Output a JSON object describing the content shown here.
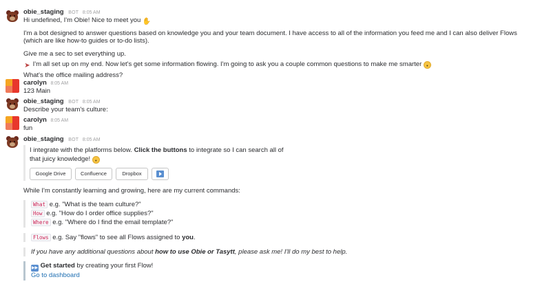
{
  "messages": {
    "m1": {
      "sender": "obie_staging",
      "bot_tag": "BOT",
      "time": "8:05 AM",
      "line1": "Hi undefined, I'm Obie!  Nice to meet you",
      "line2": "I'm a bot designed to answer questions based on knowledge you and your team document. I have access to all of the information you feed me and I can also deliver Flows (which are like how-to guides or to-do lists).",
      "line3": "Give me a sec to set everything up.",
      "line4": "I'm all set up on my end.  Now let's get some information flowing.  I'm going to ask you a couple common questions to make me smarter",
      "line5": "What's the office mailing address?"
    },
    "m2": {
      "sender": "carolyn",
      "time": "8:05 AM",
      "text": "123 Main"
    },
    "m3": {
      "sender": "obie_staging",
      "bot_tag": "BOT",
      "time": "8:05 AM",
      "text": "Describe your team's culture:"
    },
    "m4": {
      "sender": "carolyn",
      "time": "8:05 AM",
      "text": "fun"
    },
    "m5": {
      "sender": "obie_staging",
      "bot_tag": "BOT",
      "time": "8:05 AM",
      "integrate_pre": "I integrate with the platforms below. ",
      "integrate_bold": "Click the buttons",
      "integrate_post": " to integrate so I can search all of",
      "integrate_line2": "that juicy knowledge!",
      "buttons": [
        "Google Drive",
        "Confluence",
        "Dropbox"
      ],
      "commands_intro": "While I'm constantly learning and growing, here are my current commands:",
      "commands": [
        {
          "cmd": "What",
          "example": "e.g. \"What is the team culture?\""
        },
        {
          "cmd": "How",
          "example": "e.g. \"How do I order office supplies?\""
        },
        {
          "cmd": "Where",
          "example": "e.g. \"Where do I find the email template?\""
        }
      ],
      "flows_cmd": "Flows",
      "flows_pre": "e.g. Say \"flows\" to see all Flows assigned to ",
      "flows_bold": "you",
      "flows_post": ".",
      "help_pre": "If you have any additional questions about ",
      "help_bold": "how to use Obie or Tasytt",
      "help_post": ", please ask me! I'll do my best to help.",
      "started_bold": "Get started",
      "started_post": " by creating your first Flow!",
      "dashboard_link": "Go to dashboard"
    }
  },
  "colors": {
    "link": "#1f6fb2",
    "text": "#2c2d30",
    "muted": "#a0a0a2",
    "carolyn_tiles": [
      "#f5a623",
      "#e8372c",
      "#f07a5a",
      "#e8372c"
    ]
  },
  "icons": {
    "bot_avatar": "bear-avatar-icon",
    "user_avatar": "tiles-avatar-icon",
    "wave": "waving-hand-icon",
    "rocket": "rocket-icon",
    "sunglasses": "sunglasses-emoji-icon",
    "play": "play-button-icon",
    "fast_forward": "fast-forward-icon"
  }
}
